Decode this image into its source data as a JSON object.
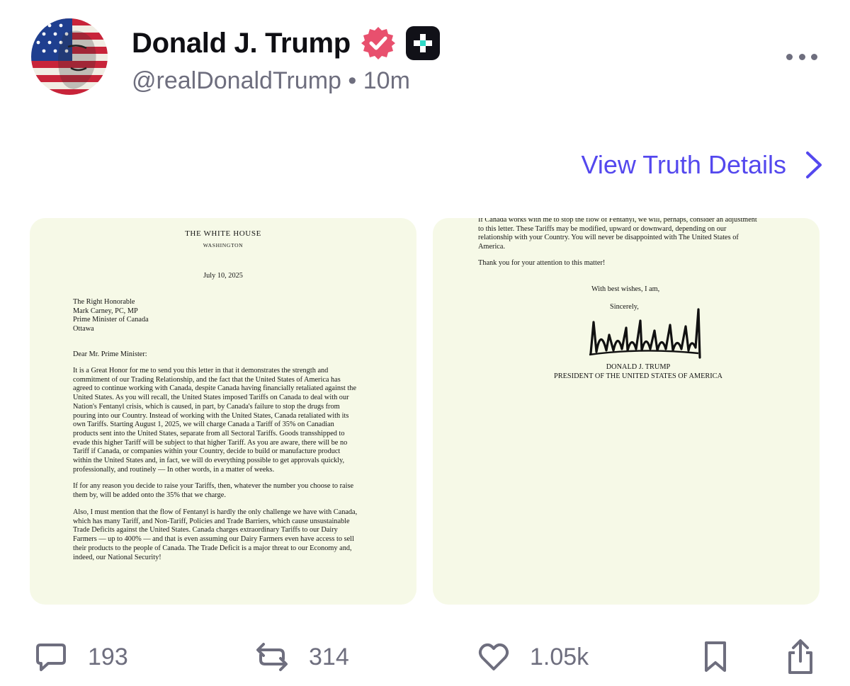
{
  "post": {
    "author_name": "Donald J. Trump",
    "handle": "@realDonaldTrump",
    "separator": "•",
    "time": "10m",
    "verified_icon": "verified-badge-icon",
    "subscription_icon": "plus-badge-icon",
    "view_details_label": "View Truth Details"
  },
  "media": {
    "left": {
      "letterhead": "THE WHITE HOUSE",
      "letterhead_sub": "WASHINGTON",
      "date": "July 10, 2025",
      "address": [
        "The Right Honorable",
        "Mark Carney, PC, MP",
        "Prime Minister of Canada",
        "Ottawa"
      ],
      "salutation": "Dear Mr. Prime Minister:",
      "paragraph1": [
        "It is a Great Honor for me to send you this letter in that it demonstrates the strength and",
        "commitment of our Trading Relationship, and the fact that the United States of America has",
        "agreed to continue working with Canada, despite Canada having financially retaliated against the",
        "United States. As you will recall, the United States imposed Tariffs on Canada to deal with our",
        "Nation's Fentanyl crisis, which is caused, in part, by Canada's failure to stop the drugs from",
        "pouring into our Country. Instead of working with the United States, Canada retaliated with its",
        "own Tariffs. Starting August 1, 2025, we will charge Canada a Tariff of 35% on Canadian",
        "products sent into the United States, separate from all Sectoral Tariffs. Goods transshipped to",
        "evade this higher Tariff will be subject to that higher Tariff. As you are aware, there will be no",
        "Tariff if Canada, or companies within your Country, decide to build or manufacture product",
        "within the United States and, in fact, we will do everything possible to get approvals quickly,",
        "professionally, and routinely — In other words, in a matter of weeks."
      ],
      "paragraph2": [
        "If for any reason you decide to raise your Tariffs, then, whatever the number you choose to raise",
        "them by, will be added onto the 35% that we charge."
      ],
      "paragraph3": [
        "Also, I must mention that the flow of Fentanyl is hardly the only challenge we have with Canada,",
        "which has many Tariff, and Non-Tariff, Policies and Trade Barriers, which cause unsustainable",
        "Trade Deficits against the United States. Canada charges extraordinary Tariffs to our Dairy",
        "Farmers — up to 400% — and that is even assuming our Dairy Farmers even have access to sell",
        "their products to the people of Canada. The Trade Deficit is a major threat to our Economy and,",
        "indeed, our National Security!"
      ]
    },
    "right": {
      "paragraph_top": [
        "If Canada works with me to stop the flow of Fentanyl, we will, perhaps, consider an adjustment",
        "to this letter. These Tariffs may be modified, upward or downward, depending on our",
        "relationship with your Country. You will never be disappointed with The United States of",
        "America."
      ],
      "thanks": "Thank you for your attention to this matter!",
      "closing1": "With best wishes, I am,",
      "closing2": "Sincerely,",
      "signer_name": "DONALD J. TRUMP",
      "signer_title": "PRESIDENT OF THE UNITED STATES OF AMERICA"
    }
  },
  "actions": {
    "reply_count": "193",
    "retruth_count": "314",
    "like_count": "1.05k",
    "icons": [
      "reply-icon",
      "retruth-icon",
      "heart-icon",
      "bookmark-icon",
      "share-icon"
    ]
  },
  "colors": {
    "accent": "#5448ee",
    "verified": "#e8506e",
    "muted": "#6e6e7e",
    "letter_paper": "#f6f9e7"
  }
}
